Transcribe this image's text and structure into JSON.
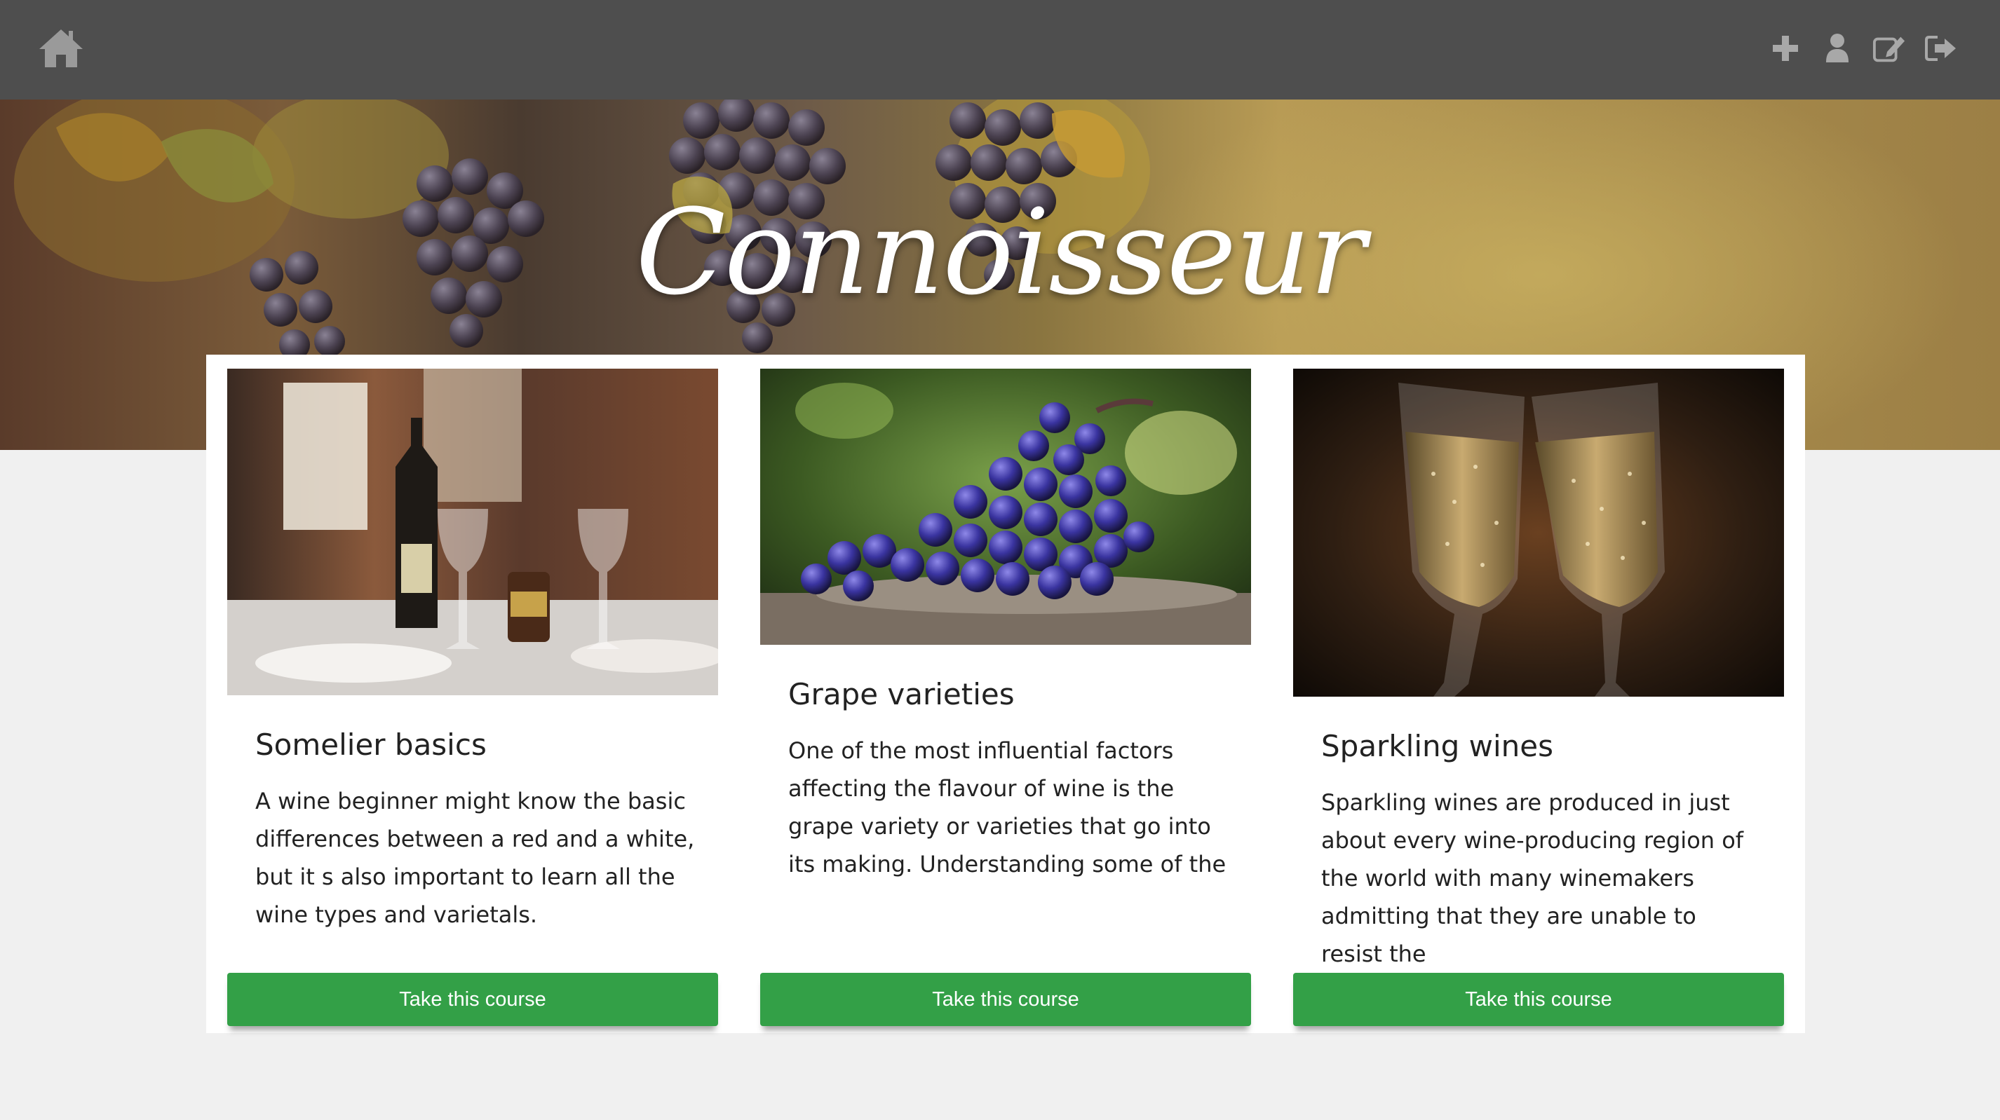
{
  "app": {
    "title": "Connoisseur"
  },
  "nav": {
    "home_icon": "home-icon",
    "actions": [
      {
        "name": "add-icon"
      },
      {
        "name": "user-icon"
      },
      {
        "name": "edit-icon"
      },
      {
        "name": "logout-icon"
      }
    ]
  },
  "colors": {
    "nav": "#4e4e4e",
    "accent": "#33a047",
    "background": "#f0f0f0"
  },
  "cards": [
    {
      "title": "Somelier basics",
      "description": "A wine beginner might know the basic differences between a red and a white, but it s also important to learn all the wine types and varietals.",
      "button": "Take this course",
      "image": "wine-table-photo"
    },
    {
      "title": "Grape varieties",
      "description": "One of the most influential factors affecting the flavour of wine is the grape variety or varieties that go into its making. Understanding some of the",
      "button": "Take this course",
      "image": "grape-bunch-photo"
    },
    {
      "title": "Sparkling wines",
      "description": "Sparkling wines are produced in just about every wine-producing region of the world with many winemakers admitting that they are unable to resist the",
      "button": "Take this course",
      "image": "champagne-glasses-photo"
    }
  ]
}
